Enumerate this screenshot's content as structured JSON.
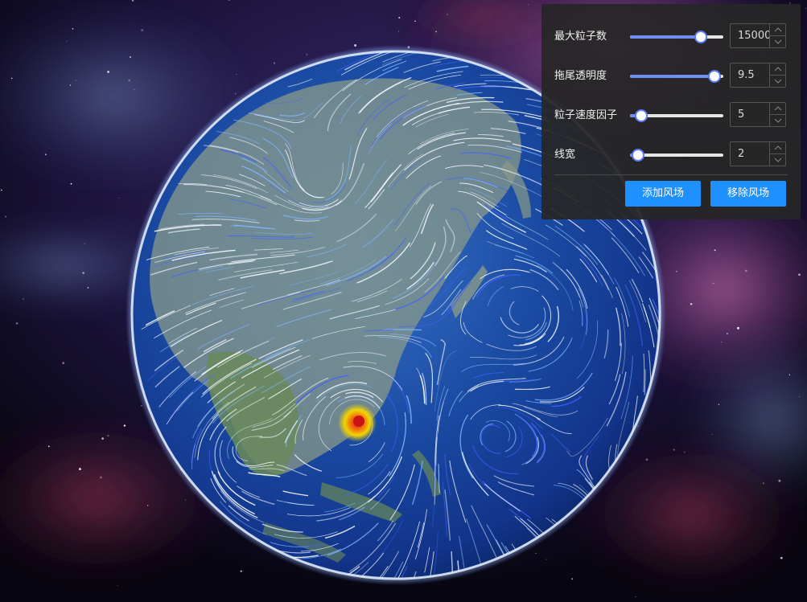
{
  "panel": {
    "sliders": [
      {
        "label": "最大粒子数",
        "value": "15000",
        "fraction": 0.75
      },
      {
        "label": "拖尾透明度",
        "value": "9.5",
        "fraction": 0.9
      },
      {
        "label": "粒子速度因子",
        "value": "5",
        "fraction": 0.11
      },
      {
        "label": "线宽",
        "value": "2",
        "fraction": 0.08
      }
    ],
    "buttons": {
      "add_label": "添加风场",
      "remove_label": "移除风场"
    }
  },
  "colors": {
    "accent": "#1e90ff",
    "slider_fill": "#6f8ff7",
    "panel_bg": "#262626",
    "ocean": "#1b4aa8",
    "typhoon": "#f2d400"
  },
  "icons": {
    "stepper_up": "chevron-up-icon",
    "stepper_down": "chevron-down-icon"
  }
}
